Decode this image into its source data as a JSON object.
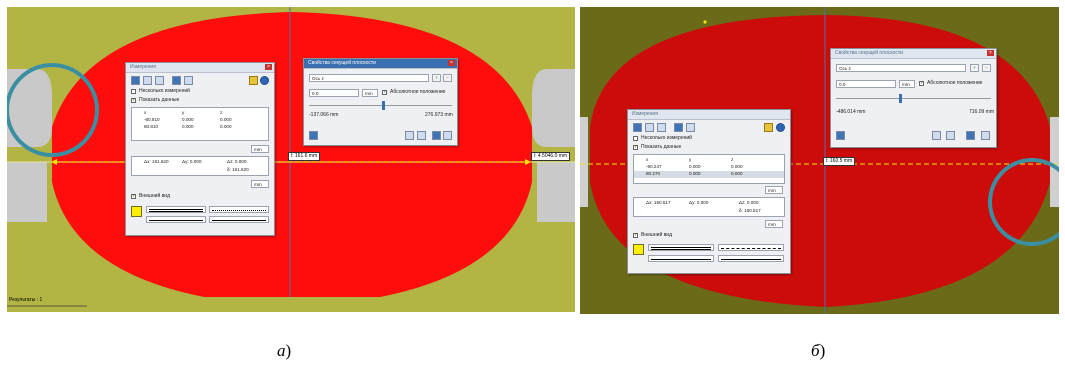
{
  "colors": {
    "panel_a_bg": "#b2b544",
    "panel_b_bg": "#6b6a18",
    "section_a": "#ff0d0d",
    "section_b": "#cc0b0b",
    "circle": "#3a8fa3",
    "dimension_line": "#f1e800"
  },
  "panel_a": {
    "measure_dialog": {
      "title": "Измерения",
      "multiple_label": "Несколько измерений",
      "show_data_label": "Показать данные",
      "headers": [
        "x",
        "y",
        "z"
      ],
      "rows": [
        [
          "-80.810",
          "0.000",
          "0.000"
        ],
        [
          "80.810",
          "0.000",
          "0.000"
        ]
      ],
      "unit": "mm",
      "dx": "Δx: 161.620",
      "dy": "Δy: 0.000",
      "dz": "Δz: 0.000",
      "distance": "δ: 161.620",
      "appearance_label": "Внешний вид"
    },
    "plane_dialog": {
      "title": "Свойства секущей плоскости",
      "axis": "Ось z",
      "value": "0.0",
      "unit": "mm",
      "absolute_label": "Абсолютное положение",
      "min": "-137.066 mm",
      "max": "276.973 mm"
    },
    "distance_tag": "l: 161.6 mm",
    "side_tag": "l: 4.5046.0 mm",
    "status_text": "Результаты : 1"
  },
  "panel_b": {
    "measure_dialog": {
      "title": "Измерения",
      "multiple_label": "Несколько измерений",
      "show_data_label": "Показать данные",
      "headers": [
        "x",
        "y",
        "z"
      ],
      "rows": [
        [
          "-80.247",
          "0.000",
          "0.000"
        ],
        [
          "80.270",
          "0.000",
          "0.000"
        ]
      ],
      "unit": "mm",
      "dx": "Δx: 160.517",
      "dy": "Δy: 0.000",
      "dz": "Δz: 0.000",
      "distance": "δ: 160.517",
      "appearance_label": "Внешний вид"
    },
    "plane_dialog": {
      "title": "Свойства секущей плоскости",
      "axis": "Ось z",
      "value": "0.0",
      "unit": "mm",
      "absolute_label": "Абсолютное положение",
      "min": "-486.014 mm",
      "max": "716.09 mm"
    },
    "distance_tag": "l: 160.5 mm"
  },
  "captions": {
    "a": "а",
    "b": "б"
  }
}
